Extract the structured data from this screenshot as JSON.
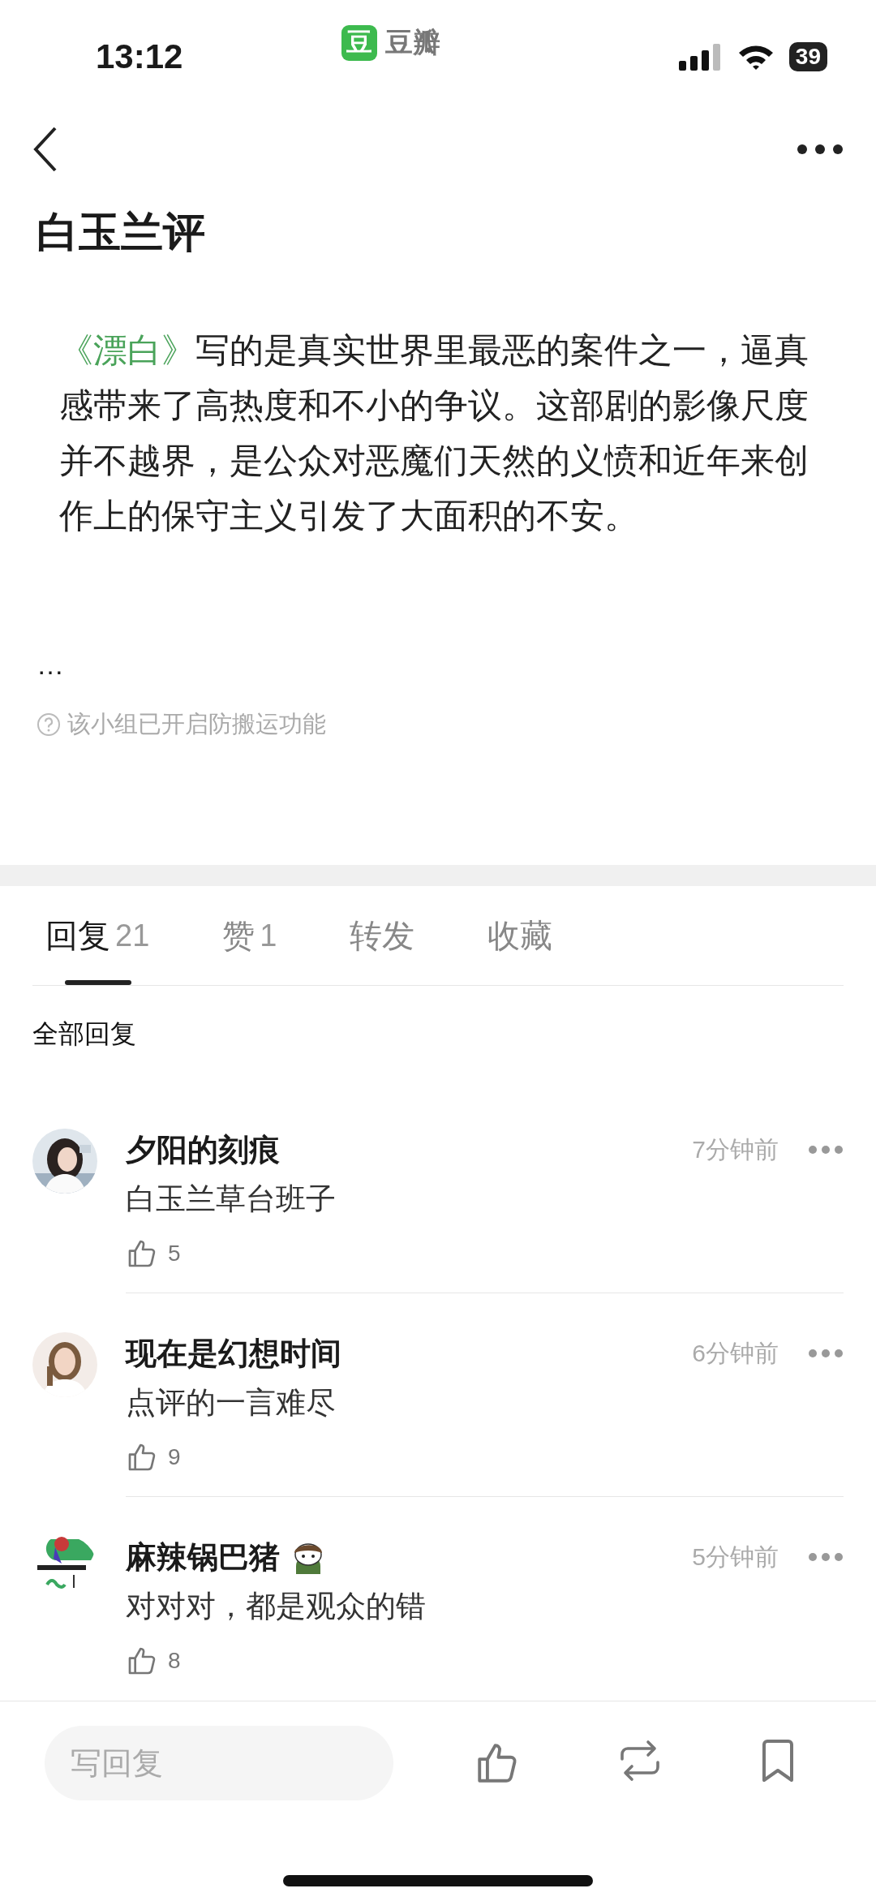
{
  "status_bar": {
    "time": "13:12",
    "app_logo": "豆",
    "app_name": "豆瓣",
    "battery": "39"
  },
  "post": {
    "title": "白玉兰评",
    "link": "《漂白》",
    "body": "写的是真实世界里最恶的案件之一，逼真感带来了高热度和不小的争议。这部剧的影像尺度并不越界，是公众对恶魔们天然的义愤和近年来创作上的保守主义引发了大面积的不安。",
    "ellipsis": "…",
    "notice": "该小组已开启防搬运功能"
  },
  "tabs": [
    {
      "label": "回复",
      "count": "21",
      "selected": true
    },
    {
      "label": "赞",
      "count": "1",
      "selected": false
    },
    {
      "label": "转发",
      "selected": false
    },
    {
      "label": "收藏",
      "selected": false
    }
  ],
  "section_title": "全部回复",
  "comments": [
    {
      "name": "夕阳的刻痕",
      "time": "7分钟前",
      "text": "白玉兰草台班子",
      "likes": "5",
      "badge": false
    },
    {
      "name": "现在是幻想时间",
      "time": "6分钟前",
      "text": "点评的一言难尽",
      "likes": "9",
      "badge": false
    },
    {
      "name": "麻辣锅巴猪",
      "time": "5分钟前",
      "text": "对对对，都是观众的错",
      "likes": "8",
      "badge": true
    }
  ],
  "reply_field": {
    "placeholder": "写回复"
  }
}
